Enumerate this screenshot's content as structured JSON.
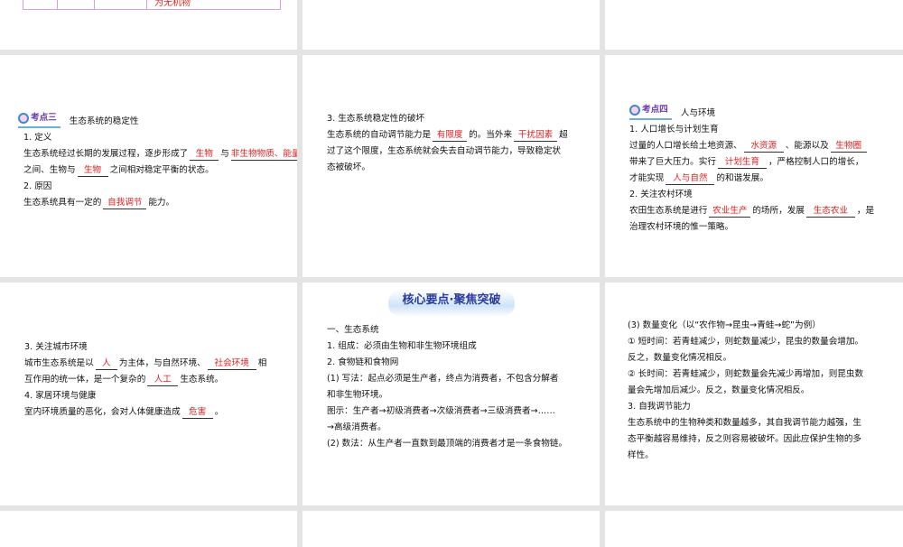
{
  "slide_top_left": {
    "cell_text": "为无机物"
  },
  "slide_a": {
    "badge": "考点三",
    "title": "生态系统的稳定性",
    "h1": "1. 定义",
    "l1a": "生态系统经过长期的发展过程，逐步形成了",
    "b1": "生物",
    "l1b": "与",
    "b2": "非生物物质、能量",
    "l2b": "之间、生物与",
    "b3": "生物",
    "l2c": "之间相对稳定平衡的状态。",
    "h2": "2. 原因",
    "l3a": "生态系统具有一定的",
    "b4": "自我调节",
    "l3b": "能力。"
  },
  "slide_b": {
    "h1": "3. 生态系统稳定性的破坏",
    "l1a": "生态系统的自动调节能力是",
    "b1": "有限度",
    "l1b": "的。当外来",
    "b2": "干扰因素",
    "l1c": "超",
    "l2": "过了这个限度，生态系统就会失去自动调节能力，导致稳定状",
    "l3": "态被破坏。"
  },
  "slide_c": {
    "badge": "考点四",
    "title": "人与环境",
    "h1": "1. 人口增长与计划生育",
    "l1a": "过量的人口增长给土地资源、",
    "b1": "水资源",
    "l1b": "、能源以及",
    "b2": "生物圈",
    "l2a": "带来了巨大压力。实行",
    "b3": "计划生育",
    "l2b": "，严格控制人口的增长，",
    "l3a": "才能实现",
    "b4": "人与自然",
    "l3b": "的和谐发展。",
    "h2": "2. 关注农村环境",
    "l4a": "农田生态系统是进行",
    "b5": "农业生产",
    "l4b": "的场所，发展",
    "b6": "生态农业",
    "l4c": "，是",
    "l5": "治理农村环境的惟一策略。"
  },
  "slide_d": {
    "h1": "3. 关注城市环境",
    "l1a": "城市生态系统是以",
    "b1": "人",
    "l1b": "为主体，与自然环境、",
    "b2": "社会环境",
    "l1c": "相",
    "l2a": "互作用的统一体，是一个复杂的",
    "b3": "人工",
    "l2b": "生态系统。",
    "h2": "4. 家居环境与健康",
    "l3a": "室内环境质量的恶化，会对人体健康造成",
    "b4": "危害",
    "l3b": "。"
  },
  "slide_e": {
    "banner": "核心要点·聚焦突破",
    "lines": [
      "一、生态系统",
      "1. 组成：必须由生物和非生物环境组成",
      "2. 食物链和食物网",
      "(1) 写法：起点必须是生产者，终点为消费者，不包含分解者",
      "和非生物环境。",
      "图示：生产者→初级消费者→次级消费者→三级消费者→……",
      "→高级消费者。",
      "(2) 数法：从生产者一直数到最顶端的消费者才是一条食物链。"
    ]
  },
  "slide_f": {
    "lines": [
      "(3) 数量变化（以“农作物→昆虫→青蛙→蛇”为例）",
      "① 短时间：若青蛙减少，则蛇数量减少，昆虫的数量会增加。",
      "反之，数量变化情况相反。",
      "② 长时间：若青蛙减少，则蛇数量会先减少再增加，则昆虫数",
      "量会先增加后减少。反之，数量变化情况相反。",
      "3. 自我调节能力",
      "生态系统中的生物种类和数量越多，其自我调节能力越强，生",
      "态平衡越容易维持，反之则容易被破坏。因此应保护生物的多",
      "样性。"
    ]
  }
}
